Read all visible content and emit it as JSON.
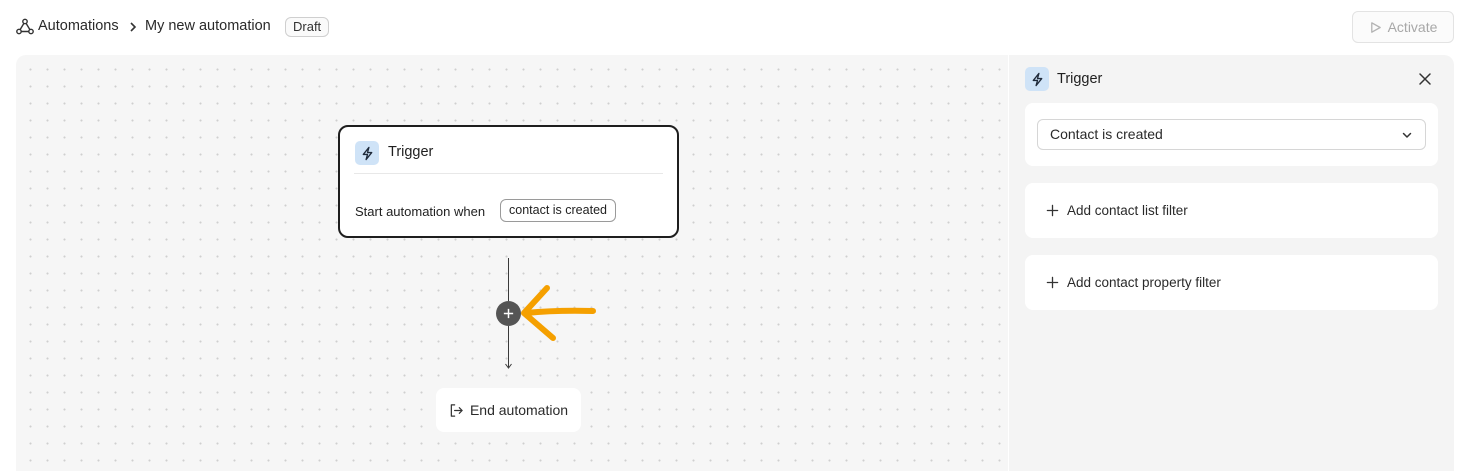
{
  "header": {
    "breadcrumb_root": "Automations",
    "breadcrumb_current": "My new automation",
    "status_badge": "Draft",
    "activate_label": "Activate"
  },
  "canvas": {
    "trigger_card": {
      "title": "Trigger",
      "start_text": "Start automation when",
      "event_pill": "contact is created"
    },
    "end_node_label": "End automation"
  },
  "panel": {
    "title": "Trigger",
    "event_select_value": "Contact is created",
    "add_list_filter_label": "Add contact list filter",
    "add_property_filter_label": "Add contact property filter"
  },
  "icons": {
    "breadcrumb": "automation-nodes-icon",
    "separator": "chevron-right-icon",
    "activate": "play-icon",
    "trigger": "lightning-bolt-icon",
    "add_step": "plus-icon",
    "end": "exit-arrow-icon",
    "close": "close-icon",
    "select": "chevron-down-icon",
    "filter_add": "plus-icon"
  },
  "colors": {
    "trigger_icon_bg": "#cfe3f7",
    "annotation_arrow": "#f5a000",
    "canvas_bg": "#f6f6f6",
    "add_step_bg": "#555555"
  }
}
